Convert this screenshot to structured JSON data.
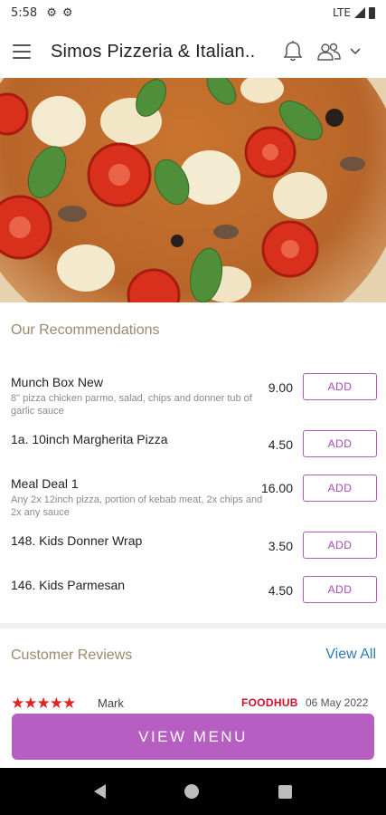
{
  "status_bar": {
    "time": "5:58",
    "network": "LTE"
  },
  "app_bar": {
    "title": "Simos Pizzeria & Italian.."
  },
  "recommendations": {
    "title": "Our Recommendations",
    "items": [
      {
        "name": "Munch Box New",
        "description": "8\" pizza chicken parmo, salad, chips and donner tub of garlic sauce",
        "price": "9.00",
        "add_label": "ADD"
      },
      {
        "name": "1a. 10inch Margherita Pizza",
        "description": "",
        "price": "4.50",
        "add_label": "ADD"
      },
      {
        "name": "Meal Deal 1",
        "description": "Any 2x 12inch pizza, portion of kebab meat, 2x chips and 2x any sauce",
        "price": "16.00",
        "add_label": "ADD"
      },
      {
        "name": "148. Kids Donner Wrap",
        "description": "",
        "price": "3.50",
        "add_label": "ADD"
      },
      {
        "name": "146. Kids Parmesan",
        "description": "",
        "price": "4.50",
        "add_label": "ADD"
      }
    ]
  },
  "reviews": {
    "title": "Customer Reviews",
    "view_all": "View All",
    "first": {
      "stars": "★★★★★",
      "rating": 5,
      "reviewer": "Mark",
      "source": "FOODHUB",
      "date": "06 May 2022"
    }
  },
  "view_menu_label": "VIEW MENU",
  "colors": {
    "accent": "#b65ec1",
    "add_border": "#b05ab8",
    "section_title": "#9a8a6c",
    "link": "#2e7bb5",
    "stars": "#e02424",
    "brand": "#d0112b"
  }
}
